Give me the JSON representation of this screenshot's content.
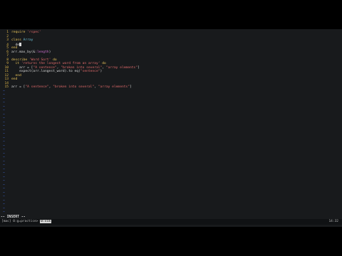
{
  "editor": {
    "lines": [
      {
        "num": "1",
        "parts": [
          {
            "t": "require ",
            "c": "kw"
          },
          {
            "t": "'rspec'",
            "c": "str"
          }
        ]
      },
      {
        "num": "2",
        "parts": []
      },
      {
        "num": "3",
        "parts": [
          {
            "t": "class ",
            "c": "kw"
          },
          {
            "t": "Array",
            "c": "cls"
          }
        ]
      },
      {
        "num": "4",
        "parts": [
          {
            "t": "  de",
            "c": ""
          }
        ],
        "cursor": true
      },
      {
        "num": "5",
        "parts": [
          {
            "t": "end",
            "c": "kw"
          }
        ]
      },
      {
        "num": "6",
        "parts": [
          {
            "t": "arr.max_by(&",
            "c": ""
          },
          {
            "t": ":length",
            "c": "sym"
          },
          {
            "t": ")",
            "c": ""
          }
        ]
      },
      {
        "num": "7",
        "parts": []
      },
      {
        "num": "8",
        "parts": [
          {
            "t": "describe ",
            "c": "kw"
          },
          {
            "t": "'Word Sort'",
            "c": "str"
          },
          {
            "t": " do",
            "c": "kw"
          }
        ]
      },
      {
        "num": "9",
        "parts": [
          {
            "t": "  it ",
            "c": "kw"
          },
          {
            "t": "'returns the longest word from an array'",
            "c": "str"
          },
          {
            "t": " do",
            "c": "kw"
          }
        ]
      },
      {
        "num": "10",
        "parts": [
          {
            "t": "    arr = [",
            "c": ""
          },
          {
            "t": "\"A sentence\"",
            "c": "str"
          },
          {
            "t": ", ",
            "c": ""
          },
          {
            "t": "\"broken into several\"",
            "c": "str"
          },
          {
            "t": ", ",
            "c": ""
          },
          {
            "t": "\"array elements\"",
            "c": "str"
          },
          {
            "t": "]",
            "c": ""
          }
        ]
      },
      {
        "num": "11",
        "parts": [
          {
            "t": "    expect(arr.longest_word).to eq(",
            "c": ""
          },
          {
            "t": "\"sentence\"",
            "c": "str"
          },
          {
            "t": ")",
            "c": ""
          }
        ]
      },
      {
        "num": "12",
        "parts": [
          {
            "t": "  end",
            "c": "kw"
          }
        ]
      },
      {
        "num": "13",
        "parts": [
          {
            "t": "end",
            "c": "kw"
          }
        ]
      },
      {
        "num": "14",
        "parts": []
      },
      {
        "num": "15",
        "parts": [
          {
            "t": "arr = [",
            "c": ""
          },
          {
            "t": "\"A sentence\"",
            "c": "str"
          },
          {
            "t": ", ",
            "c": ""
          },
          {
            "t": "\"broken into several\"",
            "c": "str"
          },
          {
            "t": ", ",
            "c": ""
          },
          {
            "t": "\"array elements\"",
            "c": "str"
          },
          {
            "t": "]",
            "c": ""
          }
        ]
      }
    ],
    "tilde_rows": 32,
    "tilde_char": "~"
  },
  "watermark": {
    "text": "devCamp"
  },
  "mode_line": "-- INSERT --",
  "status": {
    "left": "[mac] 0:g=practice> ",
    "highlight": "0:vim",
    "time": "14:32"
  },
  "colors": {
    "background": "#181a1c",
    "tilde": "#3d63c9",
    "keyword": "#e8c35a",
    "string": "#e06a6a"
  }
}
